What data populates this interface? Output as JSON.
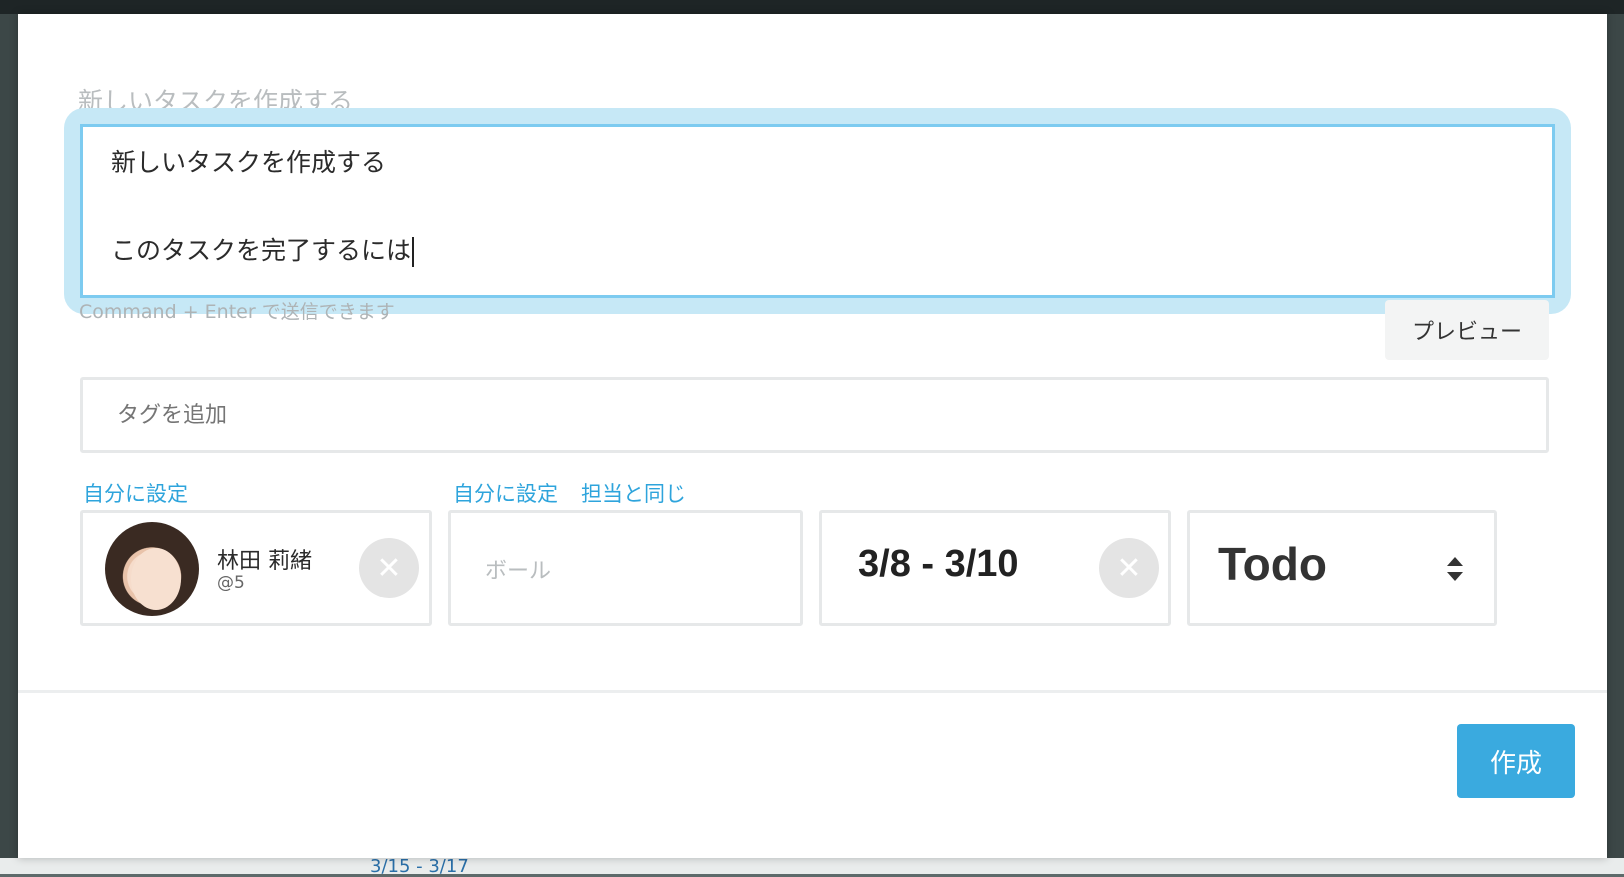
{
  "form": {
    "title_hint": "新しいタスクを作成する",
    "body_line1": "新しいタスクを作成する",
    "body_line2": "このタスクを完了するには",
    "send_hint": "Command + Enter で送信できます",
    "preview_label": "プレビュー",
    "tag_placeholder": "タグを追加"
  },
  "assignee": {
    "set_self_label": "自分に設定",
    "name": "林田 莉緒",
    "handle": "@5",
    "clear_icon": "✕"
  },
  "ball": {
    "set_self_label": "自分に設定",
    "same_as_assignee_label": "担当と同じ",
    "placeholder": "ボール"
  },
  "date": {
    "range": "3/8 - 3/10",
    "clear_icon": "✕"
  },
  "status": {
    "value": "Todo"
  },
  "footer": {
    "create_label": "作成"
  },
  "background": {
    "date_peek": "3/15 - 3/17"
  },
  "colors": {
    "accent": "#3aaadf",
    "link": "#2ea4dc",
    "focus_border": "#7dcbf0"
  }
}
